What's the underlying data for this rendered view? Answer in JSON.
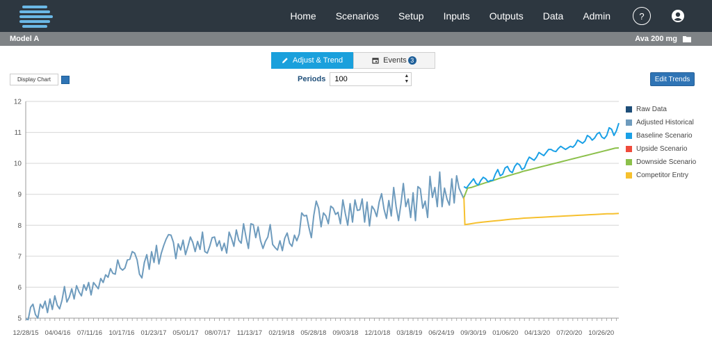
{
  "header": {
    "nav": [
      "Home",
      "Scenarios",
      "Setup",
      "Inputs",
      "Outputs",
      "Data",
      "Admin"
    ],
    "help_label": "?"
  },
  "subheader": {
    "model_name": "Model A",
    "product": "Ava 200 mg"
  },
  "tabs": {
    "adjust_label": "Adjust & Trend",
    "events_label": "Events",
    "events_count": "3"
  },
  "controls": {
    "display_chart_label": "Display Chart",
    "periods_label": "Periods",
    "periods_value": "100",
    "edit_trends_label": "Edit Trends"
  },
  "colors": {
    "raw": "#1e4e79",
    "adjusted": "#6e9bbd",
    "baseline": "#1aa0e6",
    "upside": "#ef4b3c",
    "downside": "#8cc04b",
    "competitor": "#f6c02e"
  },
  "chart_data": {
    "type": "line",
    "ylim": [
      5,
      12
    ],
    "yticks": [
      5,
      6,
      7,
      8,
      9,
      10,
      11,
      12
    ],
    "xtick_labels": [
      "12/28/15",
      "04/04/16",
      "07/11/16",
      "10/17/16",
      "01/23/17",
      "05/01/17",
      "08/07/17",
      "11/13/17",
      "02/19/18",
      "05/28/18",
      "09/03/18",
      "12/10/18",
      "03/18/19",
      "06/24/19",
      "09/30/19",
      "01/06/20",
      "04/13/20",
      "07/20/20",
      "10/26/20"
    ],
    "legend": [
      "Raw Data",
      "Adjusted Historical",
      "Baseline Scenario",
      "Upside Scenario",
      "Downside Scenario",
      "Competitor Entry"
    ],
    "series": [
      {
        "name": "Adjusted Historical",
        "values": [
          4.97,
          4.95,
          5.35,
          5.45,
          5.12,
          5,
          5.45,
          5.32,
          5.55,
          5.18,
          5.62,
          5.28,
          5.72,
          5.42,
          5.3,
          5.58,
          6.02,
          5.52,
          5.68,
          5.95,
          5.62,
          6.05,
          5.85,
          5.72,
          6.08,
          5.9,
          6.15,
          5.75,
          6.15,
          6.05,
          5.95,
          6.28,
          6.15,
          6.4,
          6.32,
          6.6,
          6.45,
          6.42,
          6.88,
          6.62,
          6.55,
          6.62,
          6.88,
          6.9,
          7.15,
          7.1,
          6.88,
          6.42,
          6.3,
          6.8,
          7.05,
          6.58,
          7.15,
          6.8,
          7.35,
          6.75,
          7.1,
          7.35,
          7.55,
          7.7,
          7.68,
          7.45,
          6.92,
          7.4,
          7.2,
          7.52,
          7.05,
          7.32,
          7.62,
          7.45,
          7.15,
          7.48,
          7.22,
          7.78,
          7.15,
          7.1,
          7.32,
          7.6,
          7.62,
          7.32,
          7.5,
          7.18,
          7.42,
          7.1,
          7.78,
          7.58,
          7.32,
          7.85,
          7.52,
          7.42,
          8.05,
          7.62,
          7.25,
          8.05,
          8.02,
          7.6,
          7.95,
          7.5,
          7.25,
          7.48,
          7.62,
          8.02,
          7.38,
          7.28,
          7.2,
          7.5,
          7.18,
          7.58,
          7.75,
          7.42,
          7.32,
          7.68,
          7.5,
          7.72,
          8.4,
          8.3,
          8.32,
          7.92,
          7.6,
          8.32,
          8.78,
          8.55,
          7.95,
          8.4,
          8.3,
          8.05,
          8.62,
          8.55,
          8.35,
          8.42,
          8.05,
          8.82,
          8.38,
          8.0,
          8.7,
          8.1,
          8.82,
          8.48,
          8.5,
          8.85,
          8.1,
          8.75,
          7.98,
          8.62,
          8.5,
          8.28,
          8.75,
          9.02,
          8.52,
          8.22,
          8.8,
          8.3,
          9.22,
          8.6,
          8.15,
          8.7,
          9.35,
          8.6,
          8.85,
          8.25,
          9.05,
          8.15,
          9.25,
          9.18,
          8.55,
          8.78,
          8.25,
          9.58,
          8.9,
          9.22,
          8.6,
          9.72,
          8.6,
          9.2,
          8.85,
          8.65,
          9.5,
          8.72,
          9.6,
          9.2,
          9.02,
          8.85
        ]
      },
      {
        "name": "Baseline Scenario",
        "values": [
          9.25,
          9.2,
          9.3,
          9.4,
          9.5,
          9.35,
          9.3,
          9.45,
          9.55,
          9.5,
          9.4,
          9.45,
          9.45,
          9.65,
          9.8,
          9.6,
          9.65,
          9.85,
          9.9,
          9.75,
          9.7,
          9.9,
          10.0,
          9.95,
          9.8,
          9.85,
          10.05,
          10.2,
          10.15,
          10.1,
          10.2,
          10.35,
          10.3,
          10.25,
          10.35,
          10.45,
          10.45,
          10.4,
          10.38,
          10.48,
          10.55,
          10.5,
          10.45,
          10.5,
          10.55,
          10.52,
          10.6,
          10.75,
          10.7,
          10.65,
          10.72,
          10.9,
          10.85,
          10.75,
          10.82,
          10.95,
          11.0,
          10.85,
          10.8,
          10.9,
          11.15,
          11.1,
          10.9,
          11.05,
          11.3
        ]
      },
      {
        "name": "Downside Scenario",
        "values": [
          8.9,
          9.2,
          9.22,
          9.26,
          9.3,
          9.34,
          9.38,
          9.41,
          9.45,
          9.49,
          9.53,
          9.56,
          9.6,
          9.63,
          9.67,
          9.7,
          9.74,
          9.77,
          9.8,
          9.83,
          9.86,
          9.89,
          9.92,
          9.95,
          9.98,
          10.01,
          10.04,
          10.07,
          10.1,
          10.13,
          10.16,
          10.19,
          10.22,
          10.25,
          10.28,
          10.31,
          10.34,
          10.37,
          10.4,
          10.43,
          10.46,
          10.49,
          10.5
        ]
      },
      {
        "name": "Competitor Entry",
        "values": [
          8.9,
          8.02,
          8.05,
          8.08,
          8.1,
          8.12,
          8.14,
          8.16,
          8.18,
          8.2,
          8.21,
          8.23,
          8.24,
          8.25,
          8.26,
          8.27,
          8.28,
          8.29,
          8.3,
          8.31,
          8.32,
          8.33,
          8.34,
          8.35,
          8.36,
          8.37,
          8.37,
          8.38
        ]
      }
    ]
  }
}
